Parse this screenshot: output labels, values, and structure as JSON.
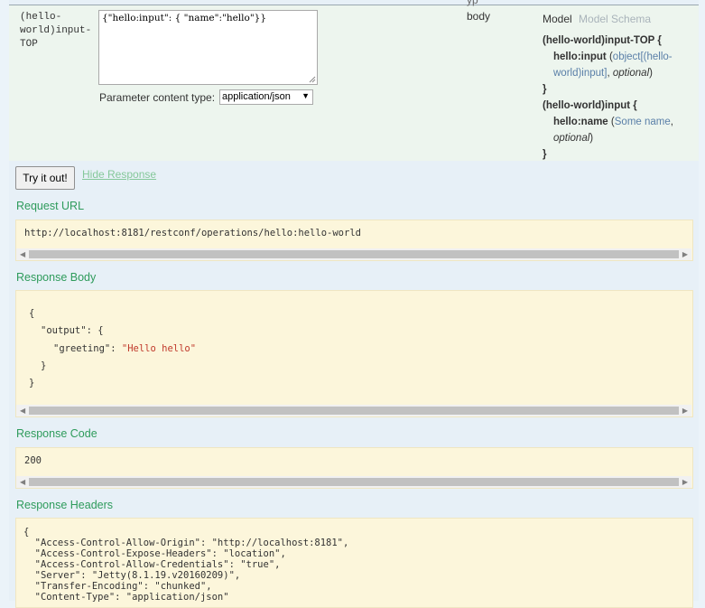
{
  "header": {
    "cutoff_text": "yp"
  },
  "parameter": {
    "name": "(hello-world)input-TOP",
    "name_lines": [
      "(hello-",
      "world)input-",
      "TOP"
    ],
    "value": "{\"hello:input\": { \"name\":\"hello\"}}",
    "content_type_label": "Parameter content type:",
    "content_type_value": "application/json",
    "param_type": "body"
  },
  "model": {
    "tab_model": "Model",
    "tab_schema": "Model Schema",
    "lines": {
      "top_open": "(hello-world)input-TOP {",
      "input_key": "hello:input",
      "input_paren_open": " (",
      "input_type": "object[(hello-world)input]",
      "input_comma": ", ",
      "input_optional": "optional",
      "input_paren_close": ")",
      "top_close": "}",
      "in_open": "(hello-world)input {",
      "name_key": "hello:name",
      "name_paren_open": " (",
      "name_type": "Some name",
      "name_comma": ",",
      "name_optional": "optional",
      "name_paren_close": ")",
      "in_close": "}"
    }
  },
  "actions": {
    "try_label": "Try it out!",
    "hide_label": "Hide Response"
  },
  "request_url": {
    "title": "Request URL",
    "value": "http://localhost:8181/restconf/operations/hello:hello-world"
  },
  "response_body": {
    "title": "Response Body",
    "l1": "{",
    "l2_key": "\"output\"",
    "l2_rest": ": {",
    "l3_key": "\"greeting\"",
    "l3_sep": ": ",
    "l3_val": "\"Hello hello\"",
    "l4": "}",
    "l5": "}"
  },
  "response_code": {
    "title": "Response Code",
    "value": "200"
  },
  "response_headers": {
    "title": "Response Headers",
    "lines": [
      "{",
      "  \"Access-Control-Allow-Origin\": \"http://localhost:8181\",",
      "  \"Access-Control-Expose-Headers\": \"location\",",
      "  \"Access-Control-Allow-Credentials\": \"true\",",
      "  \"Server\": \"Jetty(8.1.19.v20160209)\",",
      "  \"Transfer-Encoding\": \"chunked\",",
      "  \"Content-Type\": \"application/json\""
    ]
  },
  "colors": {
    "section_title": "#2e9b5b",
    "block_bg": "#fcf6db",
    "panel_bg": "#e7f0f7",
    "row_bg": "#edf5ee",
    "link": "#85c89a",
    "schema_link": "#5a7fa8"
  },
  "icons": {
    "select_arrow": "▼",
    "scroll_left": "◀",
    "scroll_right": "▶"
  }
}
